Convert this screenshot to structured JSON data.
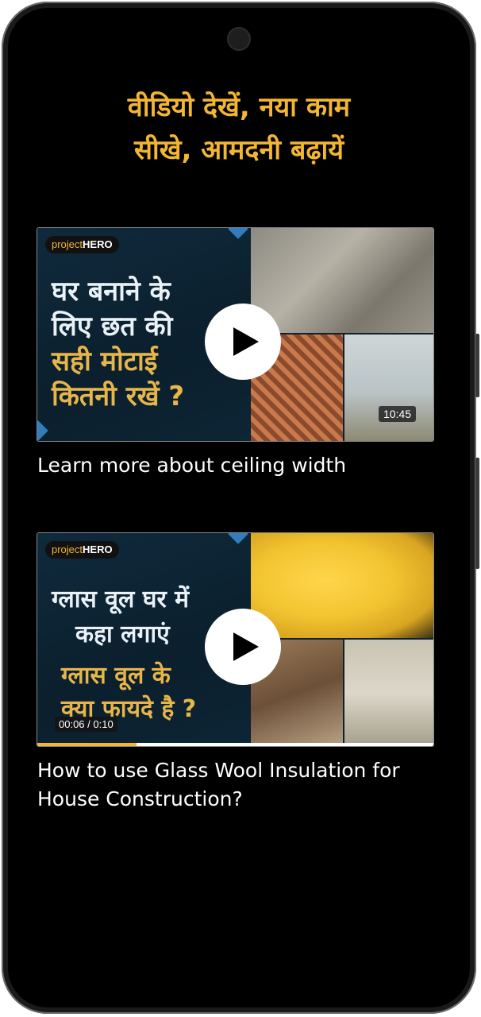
{
  "headline": {
    "line1": "वीडियो देखें, नया काम",
    "line2": "सीखे, आमदनी बढ़ायें"
  },
  "colors": {
    "accent": "#f2b632",
    "background": "#000000",
    "text": "#ffffff"
  },
  "videos": [
    {
      "brand_prefix": "project",
      "brand_suffix": "HERO",
      "thumb_lines": [
        "घर बनाने के",
        "लिए छत की",
        "सही मोटाई",
        "कितनी रखें ?"
      ],
      "duration": "10:45",
      "title": "Learn more about ceiling width",
      "play_icon": "play-icon"
    },
    {
      "brand_prefix": "project",
      "brand_suffix": "HERO",
      "thumb_lines": [
        "ग्लास वूल घर में",
        "कहा लगाएं",
        "ग्लास वूल के",
        "क्या फायदे है ?"
      ],
      "timecode": "00:06 / 0:10",
      "progress": 0.25,
      "title": "How to use Glass Wool Insulation for House Construction?",
      "play_icon": "play-icon"
    }
  ]
}
